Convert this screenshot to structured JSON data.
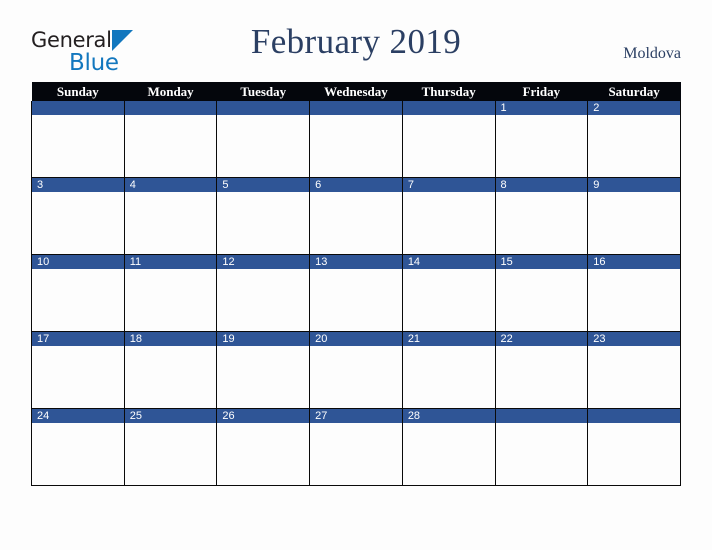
{
  "brand": {
    "name_part_1": "General",
    "name_part_2": "Blue",
    "triangle_icon": "triangle-right-icon",
    "dark_color": "#231f20",
    "blue_color": "#1277be"
  },
  "header": {
    "title": "February 2019",
    "region": "Moldova",
    "title_color": "#2b3f63"
  },
  "calendar": {
    "month": "February",
    "year": "2019",
    "accent_color": "#2f5596",
    "header_bg": "#04060c",
    "weekday_headers": [
      "Sunday",
      "Monday",
      "Tuesday",
      "Wednesday",
      "Thursday",
      "Friday",
      "Saturday"
    ],
    "weeks": [
      [
        "",
        "",
        "",
        "",
        "",
        "1",
        "2"
      ],
      [
        "3",
        "4",
        "5",
        "6",
        "7",
        "8",
        "9"
      ],
      [
        "10",
        "11",
        "12",
        "13",
        "14",
        "15",
        "16"
      ],
      [
        "17",
        "18",
        "19",
        "20",
        "21",
        "22",
        "23"
      ],
      [
        "24",
        "25",
        "26",
        "27",
        "28",
        "",
        ""
      ]
    ]
  }
}
